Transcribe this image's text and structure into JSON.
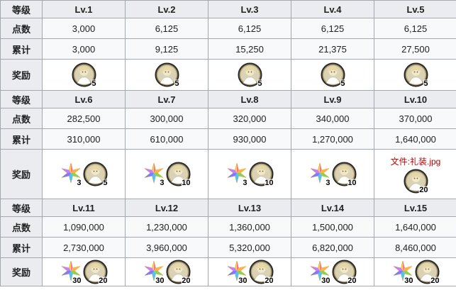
{
  "row_labels": {
    "level": "等级",
    "points": "点数",
    "cumulative": "累计",
    "reward": "奖励"
  },
  "icon_names": {
    "craft_essence": "craft-essence-icon",
    "quartz_star": "saint-quartz-icon"
  },
  "blocks": [
    {
      "levels": [
        "Lv.1",
        "Lv.2",
        "Lv.3",
        "Lv.4",
        "Lv.5"
      ],
      "points": [
        "3,000",
        "6,125",
        "6,125",
        "6,125",
        "6,125"
      ],
      "cumulative": [
        "3,000",
        "9,125",
        "15,250",
        "21,375",
        "27,500"
      ],
      "rewards": [
        {
          "star": null,
          "ce": "5"
        },
        {
          "star": null,
          "ce": "5"
        },
        {
          "star": null,
          "ce": "5"
        },
        {
          "star": null,
          "ce": "5"
        },
        {
          "star": null,
          "ce": "5"
        }
      ]
    },
    {
      "levels": [
        "Lv.6",
        "Lv.7",
        "Lv.8",
        "Lv.9",
        "Lv.10"
      ],
      "points": [
        "282,500",
        "300,000",
        "320,000",
        "340,000",
        "370,000"
      ],
      "cumulative": [
        "310,000",
        "610,000",
        "930,000",
        "1,270,000",
        "1,640,000"
      ],
      "rewards": [
        {
          "star": "3",
          "ce": "5"
        },
        {
          "star": "3",
          "ce": "10"
        },
        {
          "star": "3",
          "ce": "10"
        },
        {
          "star": "3",
          "ce": "10"
        },
        {
          "star": null,
          "ce": "20",
          "broken_link": "文件:礼装.jpg"
        }
      ]
    },
    {
      "levels": [
        "Lv.11",
        "Lv.12",
        "Lv.13",
        "Lv.14",
        "Lv.15"
      ],
      "points": [
        "1,090,000",
        "1,230,000",
        "1,360,000",
        "1,500,000",
        "1,640,000"
      ],
      "cumulative": [
        "2,730,000",
        "3,960,000",
        "5,320,000",
        "6,820,000",
        "8,460,000"
      ],
      "rewards": [
        {
          "star": "30",
          "ce": "20"
        },
        {
          "star": "30",
          "ce": "20"
        },
        {
          "star": "30",
          "ce": "20"
        },
        {
          "star": "30",
          "ce": "20"
        },
        {
          "star": "30",
          "ce": "20"
        }
      ]
    }
  ]
}
